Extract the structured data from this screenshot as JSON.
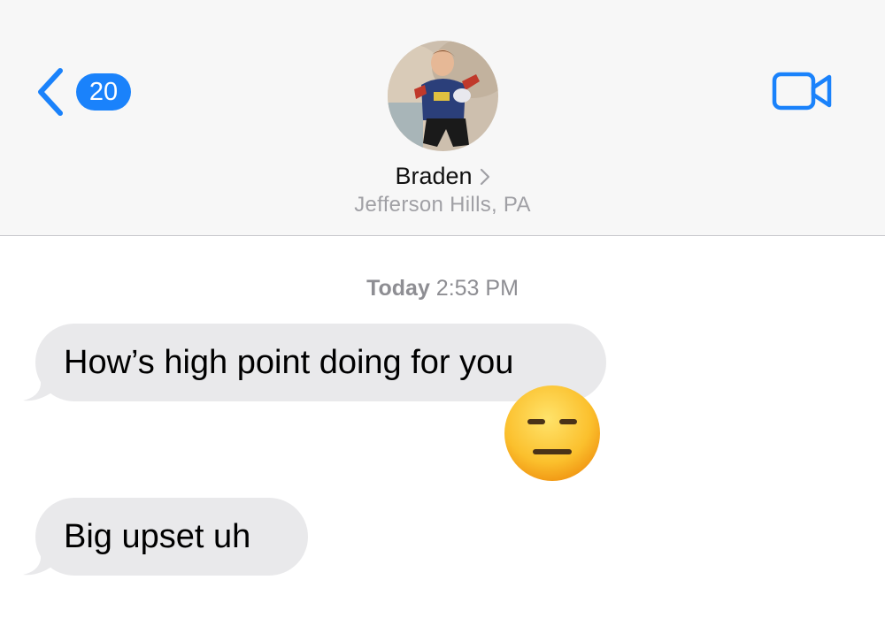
{
  "header": {
    "back_count": "20",
    "contact_name": "Braden",
    "contact_location": "Jefferson Hills, PA",
    "accent_color": "#1a82fb"
  },
  "conversation": {
    "timestamp_day": "Today",
    "timestamp_time": "2:53 PM",
    "messages": [
      {
        "text": "How’s high point doing for you",
        "direction": "incoming",
        "reaction": "expressionless-face-emoji"
      },
      {
        "text": "Big upset uh",
        "direction": "incoming"
      }
    ]
  },
  "icons": {
    "back": "chevron-left-icon",
    "video": "video-camera-icon",
    "contact_details": "chevron-right-icon"
  }
}
